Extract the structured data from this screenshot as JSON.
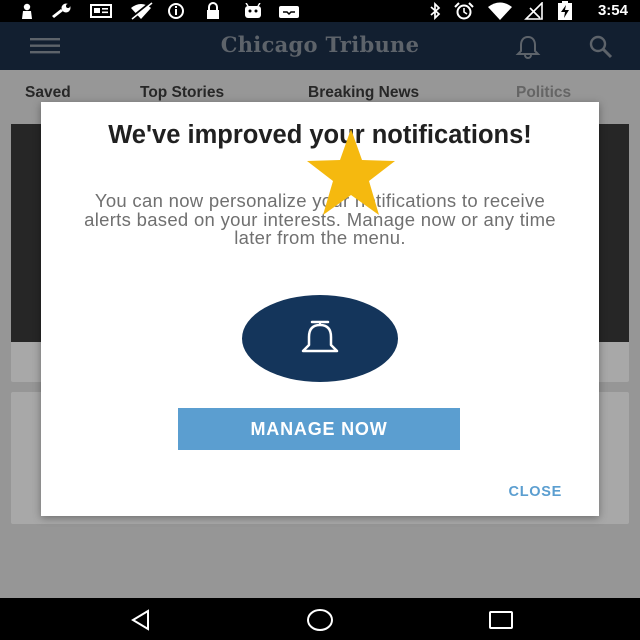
{
  "status_bar": {
    "time": "3:54",
    "left_icons": [
      "person-icon",
      "wrench-icon",
      "news-icon",
      "wifi-off-icon",
      "info-icon",
      "lock-icon",
      "android-icon",
      "inbox-icon"
    ],
    "right_icons": [
      "bluetooth-icon",
      "alarm-icon",
      "wifi-icon",
      "no-signal-icon",
      "battery-charging-icon"
    ]
  },
  "app_bar": {
    "title": "Chicago Tribune",
    "menu_icon": "hamburger-menu-icon",
    "bell_icon": "bell-icon",
    "search_icon": "search-icon"
  },
  "tabs": [
    {
      "label": "Saved"
    },
    {
      "label": "Top Stories"
    },
    {
      "label": "Breaking News"
    },
    {
      "label": "Politics"
    }
  ],
  "dialog": {
    "title": "We've improved your notifications!",
    "body": "You can now personalize your notifications to receive alerts based on your interests.  Manage now or any time later from the menu.",
    "manage_label": "MANAGE NOW",
    "close_label": "CLOSE",
    "bell_circle_color": "#14355b",
    "button_color": "#5b9ed0",
    "star_color": "#f5b90f"
  },
  "nav_bar": {
    "back_icon": "back-triangle-icon",
    "home_icon": "home-circle-icon",
    "recents_icon": "recents-square-icon"
  }
}
